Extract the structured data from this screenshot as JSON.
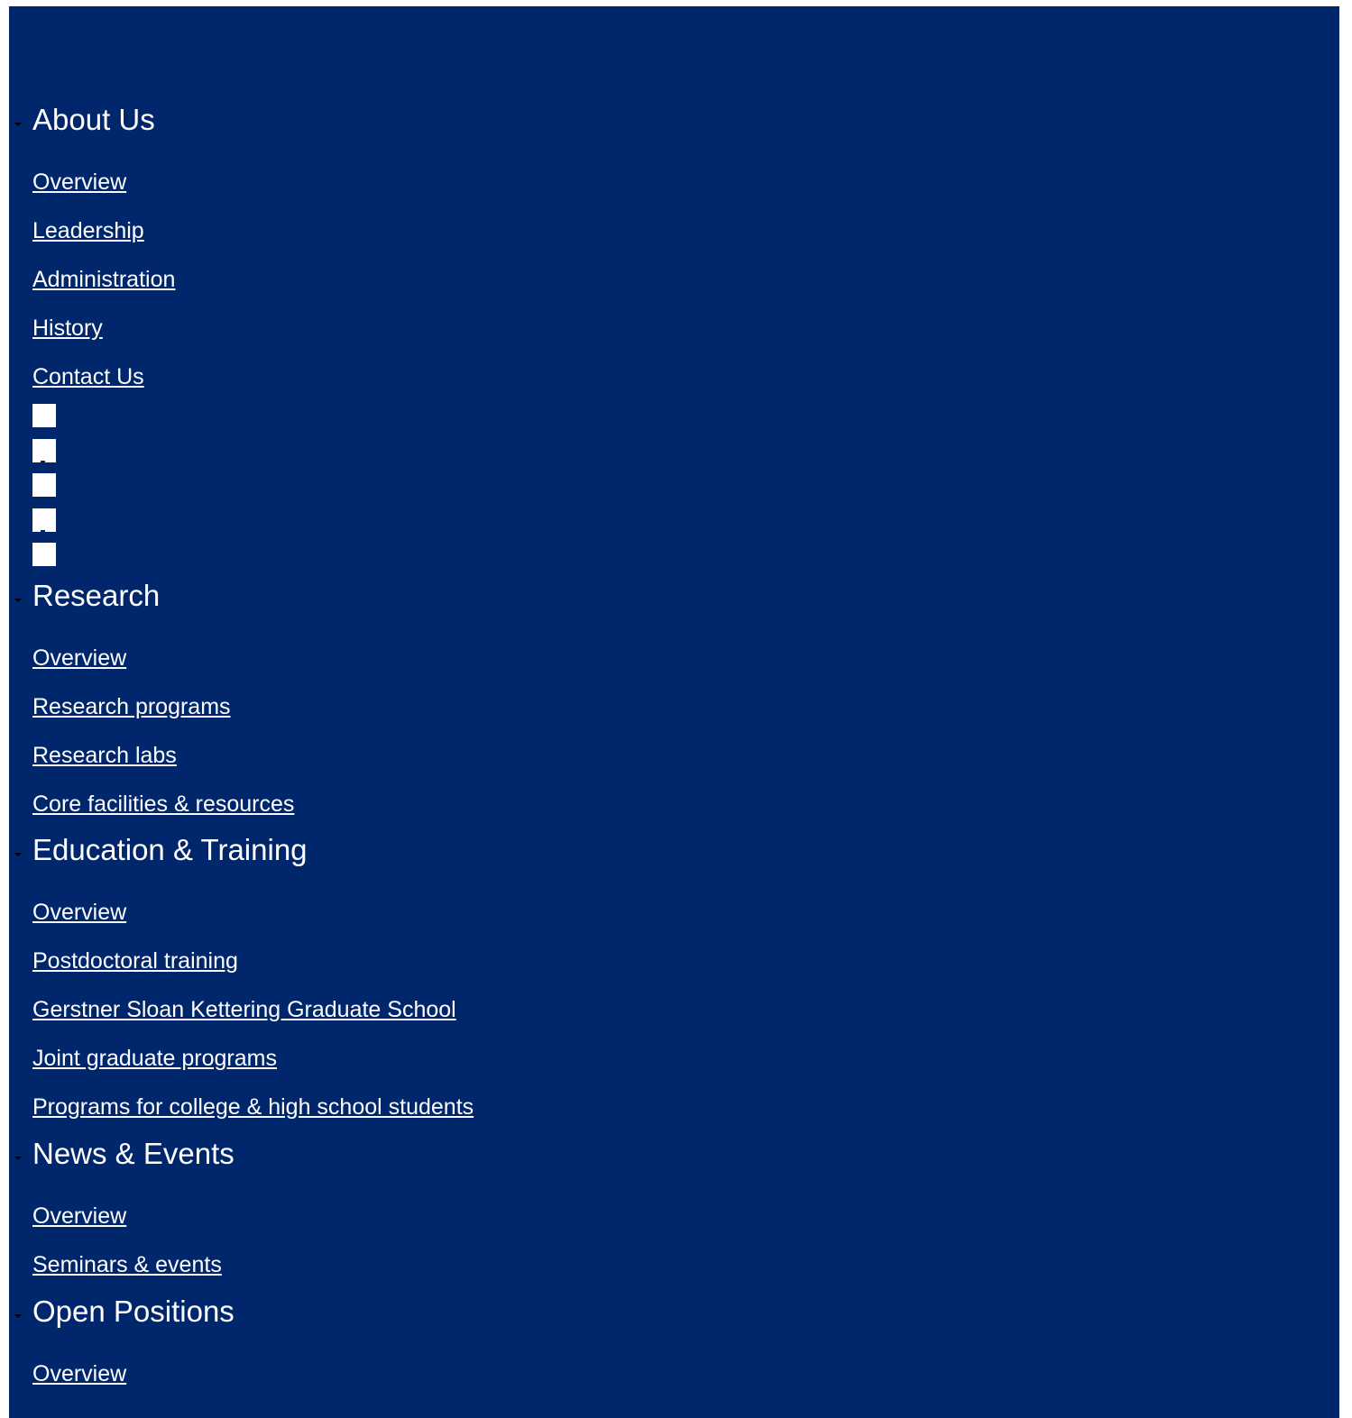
{
  "colors": {
    "panel_background": "#00266b",
    "text": "#ffffff",
    "caret": "#000000",
    "page_background": "#ffffff"
  },
  "sections": [
    {
      "title": "About Us",
      "links": [
        "Overview",
        "Leadership",
        "Administration",
        "History",
        "Contact Us"
      ]
    },
    {
      "title": "Research",
      "links": [
        "Overview",
        "Research programs",
        "Research labs",
        "Core facilities & resources"
      ]
    },
    {
      "title": "Education & Training",
      "links": [
        "Overview",
        "Postdoctoral training",
        "Gerstner Sloan Kettering Graduate School",
        "Joint graduate programs",
        "Programs for college & high school students"
      ]
    },
    {
      "title": "News & Events",
      "links": [
        "Overview",
        "Seminars & events"
      ]
    },
    {
      "title": "Open Positions",
      "links": [
        "Overview"
      ]
    }
  ],
  "social_icons": [
    "social-icon-1",
    "social-icon-2",
    "social-icon-3",
    "social-icon-4",
    "social-icon-5"
  ]
}
